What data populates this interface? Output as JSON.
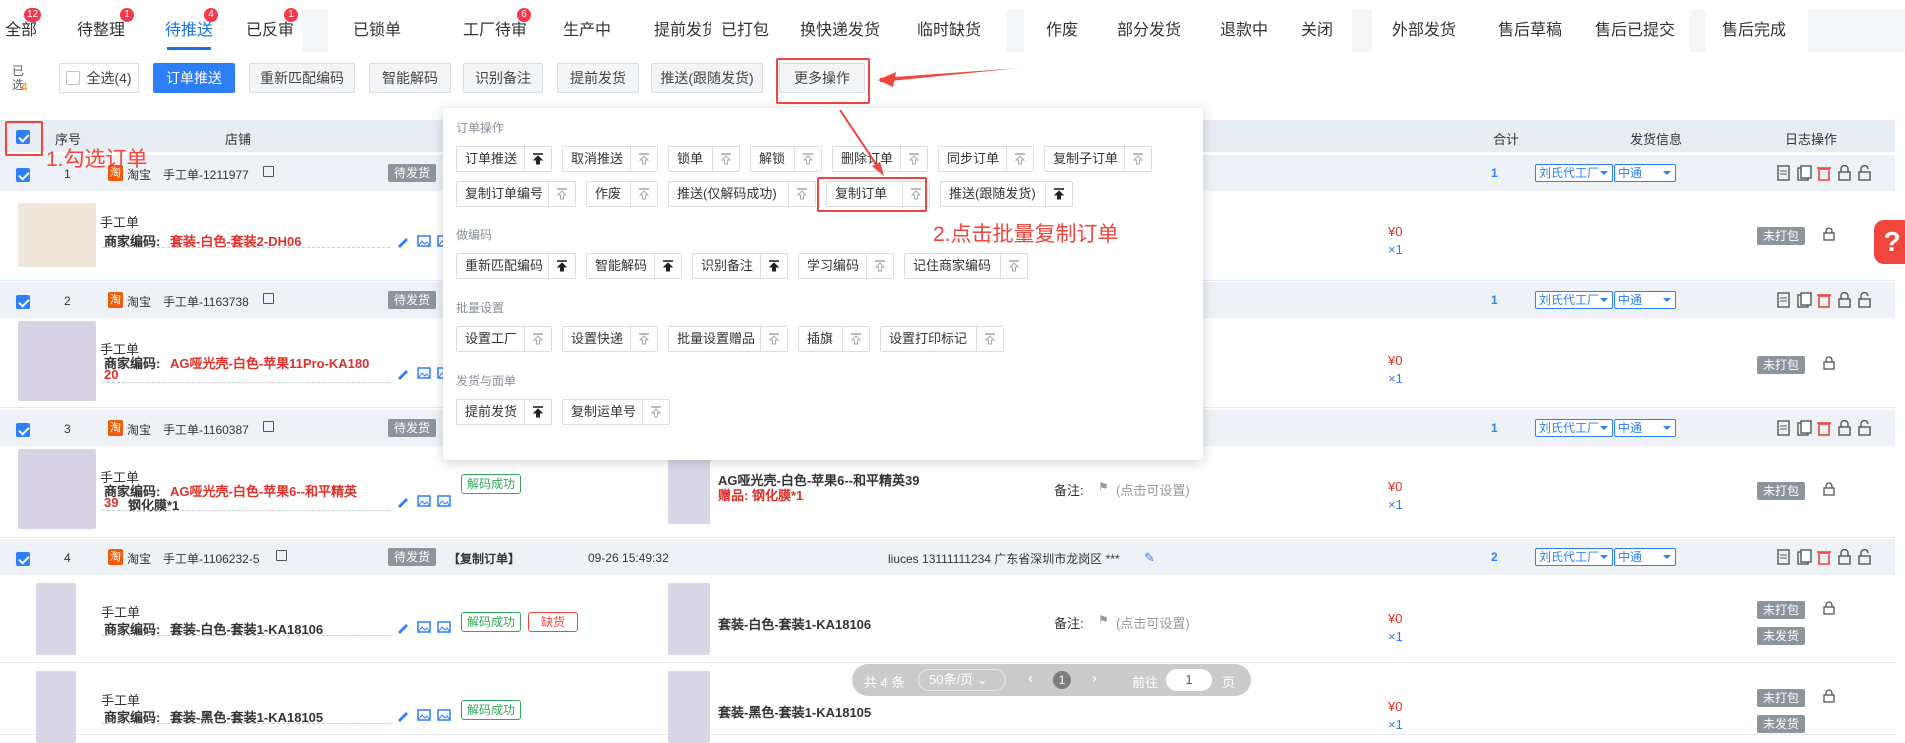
{
  "tabs": [
    {
      "label": "全部",
      "badge": "12"
    },
    {
      "label": "待整理",
      "badge": "1"
    },
    {
      "label": "待推送",
      "badge": "4",
      "active": true
    },
    {
      "label": "已反审",
      "badge": "1"
    },
    {
      "label": "已锁单",
      "badge": ""
    },
    {
      "label": "工厂待审",
      "badge": "6"
    },
    {
      "label": "生产中",
      "badge": ""
    },
    {
      "label": "提前发货",
      "badge": ""
    },
    {
      "label": "已打包",
      "badge": ""
    },
    {
      "label": "换快递发货",
      "badge": ""
    },
    {
      "label": "临时缺货",
      "badge": ""
    },
    {
      "label": "作废",
      "badge": ""
    },
    {
      "label": "部分发货",
      "badge": ""
    },
    {
      "label": "退款中",
      "badge": ""
    },
    {
      "label": "关闭",
      "badge": ""
    },
    {
      "label": "外部发货",
      "badge": ""
    },
    {
      "label": "售后草稿",
      "badge": ""
    },
    {
      "label": "售后已提交",
      "badge": ""
    },
    {
      "label": "售后完成",
      "badge": ""
    }
  ],
  "toolbar": {
    "selected_label": "已选",
    "selected_count": "4",
    "select_all": "全选(4)",
    "push_order": "订单推送",
    "rematch_code": "重新匹配编码",
    "smart_decode": "智能解码",
    "recognize_note": "识别备注",
    "early_ship": "提前发货",
    "push_with_ship": "推送(跟随发货)",
    "more_ops": "更多操作"
  },
  "table_header": {
    "seq": "序号",
    "shop": "店铺",
    "total": "合计",
    "ship_info": "发货信息",
    "log_ops": "日志操作"
  },
  "annotations": {
    "step1": "1.勾选订单",
    "step2": "2.点击批量复制订单",
    "accent": "#f0463d"
  },
  "panel": {
    "sections": [
      {
        "title": "订单操作",
        "rows": [
          [
            "订单推送",
            "取消推送",
            "锁单",
            "解锁",
            "删除订单",
            "同步订单",
            "复制子订单"
          ],
          [
            "复制订单编号",
            "作废",
            "推送(仅解码成功)",
            "复制订单",
            "推送(跟随发货)"
          ]
        ]
      },
      {
        "title": "做编码",
        "rows": [
          [
            "重新匹配编码",
            "智能解码",
            "识别备注",
            "学习编码",
            "记住商家编码"
          ]
        ]
      },
      {
        "title": "批量设置",
        "rows": [
          [
            "设置工厂",
            "设置快递",
            "批量设置赠品",
            "插旗",
            "设置打印标记"
          ]
        ]
      },
      {
        "title": "发货与面单",
        "rows": [
          [
            "提前发货",
            "复制运单号"
          ]
        ]
      }
    ]
  },
  "orders": [
    {
      "seq": "1",
      "platform": "淘宝",
      "order_no": "手工单-1211977",
      "status": "待发货",
      "total": "1",
      "factory": "刘氏代工厂",
      "express": "中通",
      "source": "手工单",
      "code_label": "商家编码:",
      "code": "套装-白色-套装2-DH06",
      "price": "¥0",
      "qty": "×1",
      "pack": "未打包"
    },
    {
      "seq": "2",
      "platform": "淘宝",
      "order_no": "手工单-1163738",
      "status": "待发货",
      "total": "1",
      "factory": "刘氏代工厂",
      "express": "中通",
      "source": "手工单",
      "code_label": "商家编码:",
      "code": "AG哑光壳-白色-苹果11Pro-KA180",
      "code2": "20",
      "price": "¥0",
      "qty": "×1",
      "pack": "未打包"
    },
    {
      "seq": "3",
      "platform": "淘宝",
      "order_no": "手工单-1160387",
      "status": "待发货",
      "total": "1",
      "factory": "刘氏代工厂",
      "express": "中通",
      "source": "手工单",
      "code_label": "商家编码:",
      "code": "AG哑光壳-白色-苹果6--和平精英",
      "code2": "39",
      "gift": "钢化膜*1",
      "decode": "解码成功",
      "product": "AG哑光壳-白色-苹果6--和平精英39",
      "product_gift": "赠品: 钢化膜*1",
      "note_label": "备注:",
      "note": "(点击可设置)",
      "price": "¥0",
      "qty": "×1",
      "pack": "未打包"
    },
    {
      "seq": "4",
      "platform": "淘宝",
      "order_no": "手工单-1106232-5",
      "status": "待发货",
      "tag": "【复制订单】",
      "time": "09-26 15:49:32",
      "buyer": "liuces  13111111234  广东省深圳市龙岗区 ***",
      "total": "2",
      "factory": "刘氏代工厂",
      "express": "中通"
    }
  ],
  "order4_items": [
    {
      "source": "手工单",
      "code_label": "商家编码:",
      "code": "套装-白色-套装1-KA18106",
      "decode": "解码成功",
      "stock": "缺货",
      "product": "套装-白色-套装1-KA18106",
      "note_label": "备注:",
      "note": "(点击可设置)",
      "price": "¥0",
      "qty": "×1",
      "pack": "未打包",
      "ship": "未发货"
    },
    {
      "source": "手工单",
      "code_label": "商家编码:",
      "code": "套装-黑色-套装1-KA18105",
      "decode": "解码成功",
      "product": "套装-黑色-套装1-KA18105",
      "price": "¥0",
      "qty": "×1",
      "pack": "未打包",
      "ship": "未发货"
    }
  ],
  "pagination": {
    "total": "共 4 条",
    "page_size": "50条/页",
    "current": "1",
    "goto": "前往",
    "goto_val": "1",
    "page_unit": "页"
  }
}
